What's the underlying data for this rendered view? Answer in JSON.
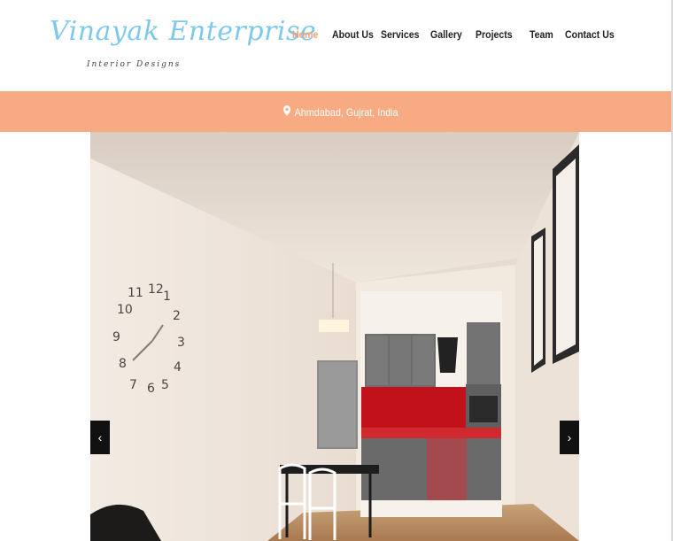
{
  "brand": {
    "name": "Vinayak Enterprise",
    "tagline": "Interior Designs"
  },
  "nav": {
    "items": [
      {
        "label": "Home",
        "active": true
      },
      {
        "label": "About Us"
      },
      {
        "label": "Services"
      },
      {
        "label": "Gallery"
      },
      {
        "label": "Projects"
      },
      {
        "label": "Team"
      },
      {
        "label": "Contact Us"
      }
    ]
  },
  "location": {
    "icon": "map-marker-icon",
    "text": "Ahmdabad, Gujrat, India"
  },
  "slider": {
    "prev_label": "‹",
    "next_label": "›"
  },
  "colors": {
    "accent": "#f8ab83",
    "logo": "#7ec8ee",
    "active_nav": "#f0a27a"
  }
}
